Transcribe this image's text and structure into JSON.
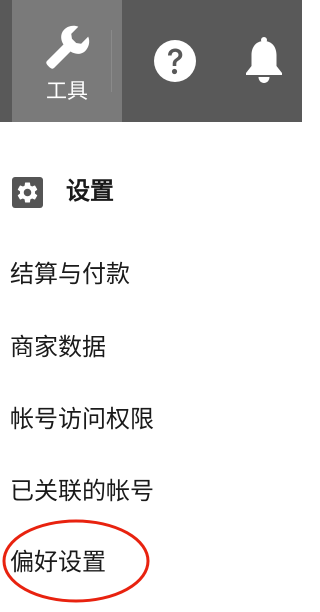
{
  "toolbar": {
    "tools_label": "工具",
    "tools_icon": "wrench-icon",
    "help_icon": "help-icon",
    "notifications_icon": "bell-icon"
  },
  "settings": {
    "title": "设置",
    "icon": "gear-icon",
    "items": [
      {
        "label": "结算与付款"
      },
      {
        "label": "商家数据"
      },
      {
        "label": "帐号访问权限"
      },
      {
        "label": "已关联的帐号"
      },
      {
        "label": "偏好设置"
      }
    ]
  },
  "colors": {
    "topbar": "#595959",
    "tools_active": "#7a7a7a",
    "highlight_circle": "#e8220f",
    "text": "#1a1a1a"
  }
}
